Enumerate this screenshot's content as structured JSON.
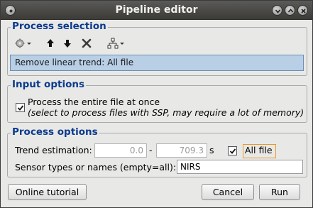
{
  "window": {
    "title": "Pipeline editor"
  },
  "process_selection": {
    "title": "Process selection",
    "toolbar_icons": [
      "gear-icon",
      "chevron-down-icon",
      "arrow-up-icon",
      "arrow-down-icon",
      "delete-x-icon",
      "tree-icon",
      "chevron-down-icon"
    ],
    "selected_process": "Remove linear trend: All file"
  },
  "input_options": {
    "title": "Input options",
    "checkbox_checked": true,
    "checkbox_label": "Process the entire file at once",
    "note": "(select to process files with SSP, may require a lot of memory)"
  },
  "process_options": {
    "title": "Process options",
    "trend_label": "Trend estimation:",
    "trend_start": "0.0",
    "dash": "-",
    "trend_end": "709.3",
    "unit": "s",
    "all_file_checked": true,
    "all_file_label": "All file",
    "sensor_label": "Sensor types or names (empty=all):",
    "sensor_value": "NIRS"
  },
  "footer": {
    "online_tutorial": "Online tutorial",
    "cancel": "Cancel",
    "run": "Run"
  }
}
